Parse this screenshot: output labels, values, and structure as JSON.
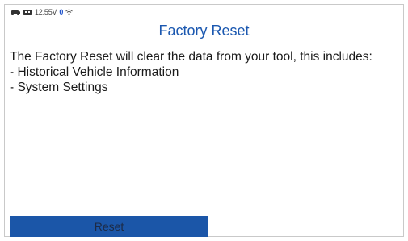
{
  "status_bar": {
    "car_icon": "car-icon",
    "connection_icon": "obd-connection-icon",
    "voltage": "12.55V",
    "count": "0",
    "wifi_icon": "wifi-icon"
  },
  "page": {
    "title": "Factory Reset",
    "description": "The Factory Reset will clear the data from your tool, this includes:",
    "items": [
      "- Historical Vehicle Information",
      "- System Settings"
    ]
  },
  "actions": {
    "reset_label": "Reset"
  },
  "colors": {
    "title": "#1b58b0",
    "button_bg": "#1b56a8",
    "count": "#2255cc"
  }
}
